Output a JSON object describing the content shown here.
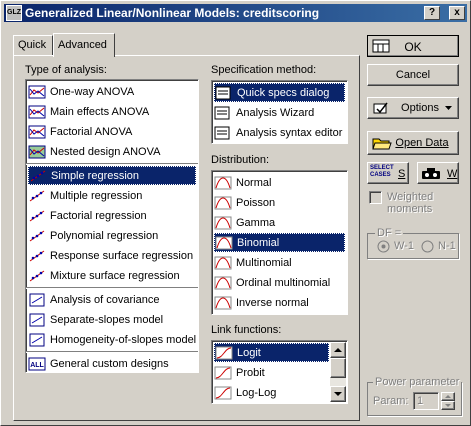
{
  "window": {
    "title": "Generalized Linear/Nonlinear Models: creditscoring",
    "app_icon_text": "GLZ"
  },
  "title_buttons": {
    "help": "?",
    "minimize": "_",
    "close": "x"
  },
  "tabs": [
    {
      "label": "Quick"
    },
    {
      "label": "Advanced"
    }
  ],
  "type_of_analysis": {
    "label": "Type of analysis:",
    "groups": [
      [
        {
          "label": "One-way ANOVA",
          "icon": "one-way-anova-icon"
        },
        {
          "label": "Main effects ANOVA",
          "icon": "main-effects-icon"
        },
        {
          "label": "Factorial ANOVA",
          "icon": "factorial-anova-icon"
        },
        {
          "label": "Nested design ANOVA",
          "icon": "nested-design-icon"
        }
      ],
      [
        {
          "label": "Simple regression",
          "icon": "simple-regression-icon",
          "selected": true
        },
        {
          "label": "Multiple regression",
          "icon": "multiple-regression-icon"
        },
        {
          "label": "Factorial regression",
          "icon": "factorial-regression-icon"
        },
        {
          "label": "Polynomial regression",
          "icon": "polynomial-regression-icon"
        },
        {
          "label": "Response surface regression",
          "icon": "response-surface-icon"
        },
        {
          "label": "Mixture surface regression",
          "icon": "mixture-surface-icon"
        }
      ],
      [
        {
          "label": "Analysis of covariance",
          "icon": "ancova-icon"
        },
        {
          "label": "Separate-slopes model",
          "icon": "separate-slopes-icon"
        },
        {
          "label": "Homogeneity-of-slopes model",
          "icon": "homogeneity-slopes-icon"
        }
      ],
      [
        {
          "label": "General custom designs",
          "icon": "custom-designs-icon",
          "icon_text": "ALL"
        }
      ]
    ]
  },
  "specification_method": {
    "label": "Specification method:",
    "items": [
      {
        "label": "Quick specs dialog",
        "icon": "quick-specs-icon",
        "selected": true
      },
      {
        "label": "Analysis Wizard",
        "icon": "wizard-icon"
      },
      {
        "label": "Analysis syntax editor",
        "icon": "syntax-editor-icon"
      }
    ]
  },
  "distribution": {
    "label": "Distribution:",
    "items": [
      {
        "label": "Normal"
      },
      {
        "label": "Poisson"
      },
      {
        "label": "Gamma"
      },
      {
        "label": "Binomial",
        "selected": true
      },
      {
        "label": "Multinomial"
      },
      {
        "label": "Ordinal multinomial"
      },
      {
        "label": "Inverse normal"
      }
    ]
  },
  "link_functions": {
    "label": "Link functions:",
    "items": [
      {
        "label": "Logit",
        "selected": true
      },
      {
        "label": "Probit"
      },
      {
        "label": "Log-Log"
      }
    ]
  },
  "buttons": {
    "ok": "OK",
    "cancel": "Cancel",
    "options": "Options",
    "open_data": "Open Data",
    "select_cases_line1": "SELECT",
    "select_cases_line2": "CASES",
    "select_cases_key": "S",
    "weights_key": "W"
  },
  "weighted_moments": {
    "line1": "Weighted",
    "line2": "moments"
  },
  "df": {
    "label": "DF =",
    "option1": "W-1",
    "option2": "N-1"
  },
  "power_parameter": {
    "label": "Power parameter",
    "param_label": "Param:",
    "value": "1"
  }
}
